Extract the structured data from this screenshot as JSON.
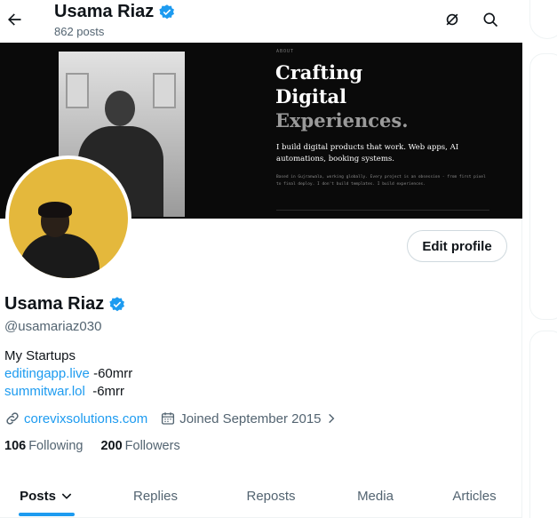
{
  "header": {
    "title": "Usama Riaz",
    "posts_count": "862 posts",
    "back_icon": "arrow-left-icon",
    "icons": [
      "grok-icon",
      "search-icon"
    ]
  },
  "banner": {
    "eyebrow": "ABOUT",
    "headline_line1": "Crafting",
    "headline_line2": "Digital",
    "headline_line3": "Experiences.",
    "tagline": "I build digital products that work. Web apps, AI automations, booking systems.",
    "small_text": "Based in Gujranwala, working globally. Every project is an obsession - from first pixel to final deploy. I don't build templates. I build experiences."
  },
  "profile": {
    "name": "Usama Riaz",
    "handle": "@usamariaz030",
    "edit_label": "Edit profile",
    "bio_line1": "My Startups",
    "bio_link1": "editingapp.live",
    "bio_link1_suffix": " -60mrr",
    "bio_link2": "summitwar.lol",
    "bio_link2_suffix": "  -6mrr",
    "website": "corevixsolutions.com",
    "joined": "Joined September 2015",
    "following_count": "106",
    "following_label": "Following",
    "followers_count": "200",
    "followers_label": "Followers"
  },
  "tabs": [
    {
      "label": "Posts",
      "active": true
    },
    {
      "label": "Replies"
    },
    {
      "label": "Reposts"
    },
    {
      "label": "Media"
    },
    {
      "label": "Articles"
    }
  ],
  "colors": {
    "accent": "#1d9bf0",
    "verified": "#1d9bf0",
    "muted_text": "#536471",
    "avatar_bg": "#e4b83c"
  }
}
